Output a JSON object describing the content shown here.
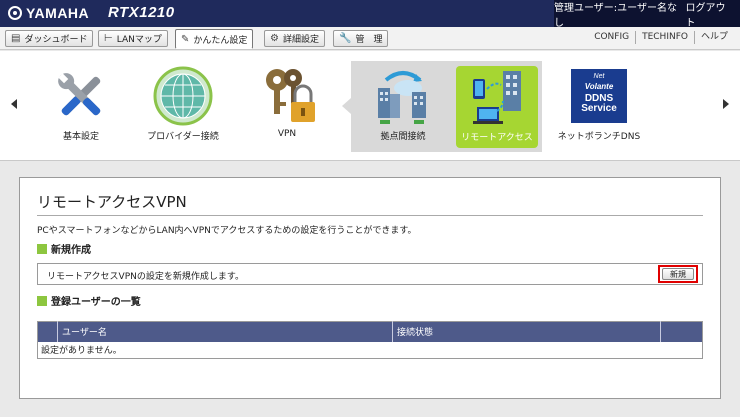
{
  "header": {
    "brand": "YAMAHA",
    "model": "RTX1210",
    "user_label": "管理ユーザー:ユーザー名なし",
    "logout": "ログアウト"
  },
  "nav": {
    "dashboard": "ダッシュボード",
    "lanmap": "LANマップ",
    "easy_setup": "かんたん設定",
    "advanced": "詳細設定",
    "management": "管　理",
    "config": "CONFIG",
    "techinfo": "TECHINFO",
    "help": "ヘルプ"
  },
  "carousel": {
    "items": [
      {
        "label": "基本設定",
        "icon": "tools-icon"
      },
      {
        "label": "プロバイダー接続",
        "icon": "globe-icon"
      },
      {
        "label": "VPN",
        "icon": "keys-lock-icon"
      },
      {
        "label": "拠点間接続",
        "icon": "site-to-site-icon"
      },
      {
        "label": "リモートアクセス",
        "icon": "remote-access-icon"
      },
      {
        "label": "ネットボランチDNS",
        "icon": "ddns-icon"
      }
    ],
    "ddns_badge": {
      "line1": "Net",
      "line2": "Volante",
      "line3": "DDNS",
      "line4": "Service"
    },
    "selected_index": 4,
    "accent_color": "#a6d632"
  },
  "page": {
    "title": "リモートアクセスVPN",
    "description": "PCやスマートフォンなどからLAN内へVPNでアクセスするための設定を行うことができます。",
    "new_section": {
      "heading": "新規作成",
      "text": "リモートアクセスVPNの設定を新規作成します。",
      "button": "新規"
    },
    "users_section": {
      "heading": "登録ユーザーの一覧",
      "columns": [
        "ユーザー名",
        "接続状態"
      ],
      "empty_text": "設定がありません。"
    }
  }
}
